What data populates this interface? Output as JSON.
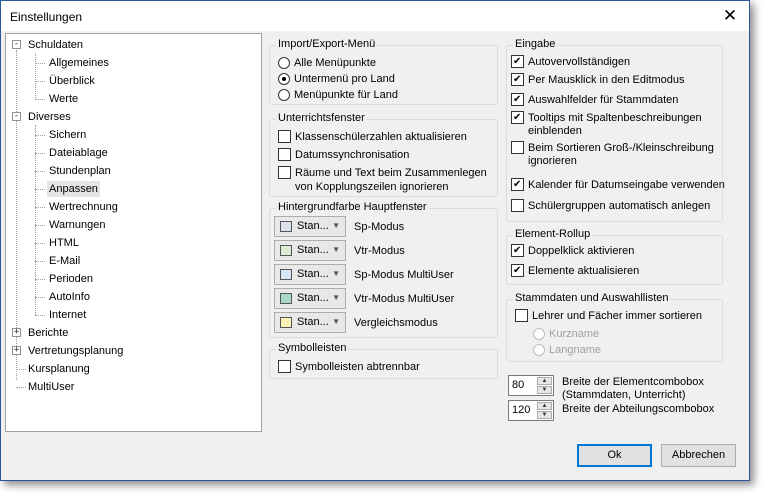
{
  "window": {
    "title": "Einstellungen",
    "close_glyph": "✕"
  },
  "tree": {
    "items": [
      {
        "label": "Schuldaten",
        "level": 0,
        "expander": "-"
      },
      {
        "label": "Allgemeines",
        "level": 1
      },
      {
        "label": "Überblick",
        "level": 1
      },
      {
        "label": "Werte",
        "level": 1
      },
      {
        "label": "Diverses",
        "level": 0,
        "expander": "-"
      },
      {
        "label": "Sichern",
        "level": 1
      },
      {
        "label": "Dateiablage",
        "level": 1
      },
      {
        "label": "Stundenplan",
        "level": 1
      },
      {
        "label": "Anpassen",
        "level": 1,
        "selected": true
      },
      {
        "label": "Wertrechnung",
        "level": 1
      },
      {
        "label": "Warnungen",
        "level": 1
      },
      {
        "label": "HTML",
        "level": 1
      },
      {
        "label": "E-Mail",
        "level": 1
      },
      {
        "label": "Perioden",
        "level": 1
      },
      {
        "label": "AutoInfo",
        "level": 1
      },
      {
        "label": "Internet",
        "level": 1
      },
      {
        "label": "Berichte",
        "level": 0,
        "expander": "+"
      },
      {
        "label": "Vertretungsplanung",
        "level": 0,
        "expander": "+"
      },
      {
        "label": "Kursplanung",
        "level": 0
      },
      {
        "label": "MultiUser",
        "level": 0
      }
    ]
  },
  "import_export": {
    "title": "Import/Export-Menü",
    "options": [
      {
        "label": "Alle Menüpunkte",
        "checked": false
      },
      {
        "label": "Untermenü pro Land",
        "checked": true
      },
      {
        "label": "Menüpunkte für Land",
        "checked": false
      }
    ]
  },
  "unterricht": {
    "title": "Unterrichtsfenster",
    "items": [
      {
        "label": "Klassenschülerzahlen aktualisieren",
        "checked": false
      },
      {
        "label": "Datumssynchronisation",
        "checked": false
      },
      {
        "label": "Räume und Text beim Zusammenlegen",
        "label2": "von Kopplungszeilen ignorieren",
        "checked": false
      }
    ]
  },
  "hintergrund": {
    "title": "Hintergrundfarbe Hauptfenster",
    "rows": [
      {
        "combo": "Stan...",
        "label": "Sp-Modus",
        "color": "#dde3ee"
      },
      {
        "combo": "Stan...",
        "label": "Vtr-Modus",
        "color": "#dcebd3"
      },
      {
        "combo": "Stan...",
        "label": "Sp-Modus MultiUser",
        "color": "#d7e6f6"
      },
      {
        "combo": "Stan...",
        "label": "Vtr-Modus MultiUser",
        "color": "#a6d9c6"
      },
      {
        "combo": "Stan...",
        "label": "Vergleichsmodus",
        "color": "#fbf3b6"
      }
    ]
  },
  "symbolleisten": {
    "title": "Symbolleisten",
    "items": [
      {
        "label": "Symbolleisten abtrennbar",
        "checked": false
      }
    ]
  },
  "eingabe": {
    "title": "Eingabe",
    "items": [
      {
        "label": "Autovervollständigen",
        "checked": true
      },
      {
        "label": "Per Mausklick in den Editmodus",
        "checked": true
      },
      {
        "label": "Auswahlfelder für Stammdaten",
        "checked": true
      },
      {
        "label": "Tooltips mit Spaltenbeschreibungen",
        "label2": "einblenden",
        "checked": true
      },
      {
        "label": "Beim Sortieren Groß-/Kleinschreibung",
        "label2": "ignorieren",
        "checked": false
      },
      {
        "label": "Kalender für Datumseingabe verwenden",
        "checked": true
      },
      {
        "label": "Schülergruppen automatisch anlegen",
        "checked": false
      }
    ]
  },
  "element_rollup": {
    "title": "Element-Rollup",
    "items": [
      {
        "label": "Doppelklick aktivieren",
        "checked": true
      },
      {
        "label": "Elemente aktualisieren",
        "checked": true
      }
    ]
  },
  "stammdaten": {
    "title": "Stammdaten und Auswahllisten",
    "checkbox": {
      "label": "Lehrer und Fächer immer sortieren",
      "checked": false
    },
    "radios": [
      {
        "label": "Kurzname",
        "checked": false
      },
      {
        "label": "Langname",
        "checked": false
      }
    ]
  },
  "widths": [
    {
      "value": "80",
      "label": "Breite der Elementcombobox",
      "label2": "(Stammdaten, Unterricht)"
    },
    {
      "value": "120",
      "label": "Breite der Abteilungscombobox"
    }
  ],
  "buttons": {
    "ok": "Ok",
    "cancel": "Abbrechen"
  }
}
